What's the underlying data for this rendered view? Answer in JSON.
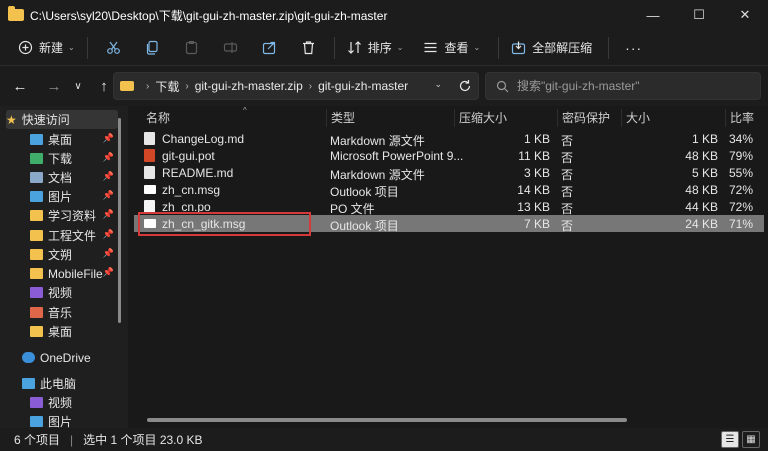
{
  "window": {
    "title": "C:\\Users\\syl20\\Desktop\\下载\\git-gui-zh-master.zip\\git-gui-zh-master",
    "minimize": "—",
    "maximize": "☐",
    "close": "✕"
  },
  "toolbar": {
    "new_label": "新建",
    "sort_label": "排序",
    "view_label": "查看",
    "extract_label": "全部解压缩",
    "more_label": "···"
  },
  "nav": {
    "back": "←",
    "forward": "→",
    "recent": "∨",
    "up": "↑"
  },
  "address": {
    "crumbs": [
      "下载",
      "git-gui-zh-master.zip",
      "git-gui-zh-master"
    ]
  },
  "search": {
    "placeholder": "搜索\"git-gui-zh-master\""
  },
  "sidebar": {
    "items": [
      {
        "label": "快速访问",
        "icon": "star-icon",
        "color": "#f2c14e"
      },
      {
        "label": "桌面",
        "icon": "desktop-icon",
        "color": "#4aa3df"
      },
      {
        "label": "下载",
        "icon": "download-icon",
        "color": "#3fae6a"
      },
      {
        "label": "文档",
        "icon": "document-icon",
        "color": "#8aa8c8"
      },
      {
        "label": "图片",
        "icon": "picture-icon",
        "color": "#4aa3df"
      },
      {
        "label": "学习资料",
        "icon": "folder-icon",
        "color": "#f2c14e"
      },
      {
        "label": "工程文件",
        "icon": "folder-icon",
        "color": "#f2c14e"
      },
      {
        "label": "文朔",
        "icon": "folder-icon",
        "color": "#f2c14e"
      },
      {
        "label": "MobileFile",
        "icon": "folder-icon",
        "color": "#f2c14e"
      },
      {
        "label": "视频",
        "icon": "video-icon",
        "color": "#8a5cd6"
      },
      {
        "label": "音乐",
        "icon": "music-icon",
        "color": "#e0664a"
      },
      {
        "label": "桌面",
        "icon": "folder-icon",
        "color": "#f2c14e"
      },
      {
        "label": "OneDrive",
        "icon": "cloud-icon",
        "color": "#3b8fd9"
      },
      {
        "label": "此电脑",
        "icon": "computer-icon",
        "color": "#4aa3df"
      },
      {
        "label": "视频",
        "icon": "video-icon",
        "color": "#8a5cd6"
      },
      {
        "label": "图片",
        "icon": "picture-icon",
        "color": "#4aa3df"
      }
    ]
  },
  "columns": [
    "名称",
    "类型",
    "压缩大小",
    "密码保护",
    "大小",
    "比率"
  ],
  "files": [
    {
      "name": "ChangeLog.md",
      "type": "Markdown 源文件",
      "packed": "1 KB",
      "password": "否",
      "size": "1 KB",
      "ratio": "34%",
      "icon": "md-file-icon"
    },
    {
      "name": "git-gui.pot",
      "type": "Microsoft PowerPoint 9...",
      "packed": "11 KB",
      "password": "否",
      "size": "48 KB",
      "ratio": "79%",
      "icon": "powerpoint-file-icon"
    },
    {
      "name": "README.md",
      "type": "Markdown 源文件",
      "packed": "3 KB",
      "password": "否",
      "size": "5 KB",
      "ratio": "55%",
      "icon": "md-file-icon"
    },
    {
      "name": "zh_cn.msg",
      "type": "Outlook 项目",
      "packed": "14 KB",
      "password": "否",
      "size": "48 KB",
      "ratio": "72%",
      "icon": "mail-file-icon"
    },
    {
      "name": "zh_cn.po",
      "type": "PO 文件",
      "packed": "13 KB",
      "password": "否",
      "size": "44 KB",
      "ratio": "72%",
      "icon": "blank-file-icon"
    },
    {
      "name": "zh_cn_gitk.msg",
      "type": "Outlook 项目",
      "packed": "7 KB",
      "password": "否",
      "size": "24 KB",
      "ratio": "71%",
      "icon": "mail-file-icon"
    }
  ],
  "status": {
    "count": "6 个项目",
    "divider": "|",
    "selection": "选中 1 个项目  23.0 KB"
  },
  "colors": {
    "selection": "#777777",
    "highlight_box": "#d43a3a",
    "folder": "#f2c14e"
  }
}
